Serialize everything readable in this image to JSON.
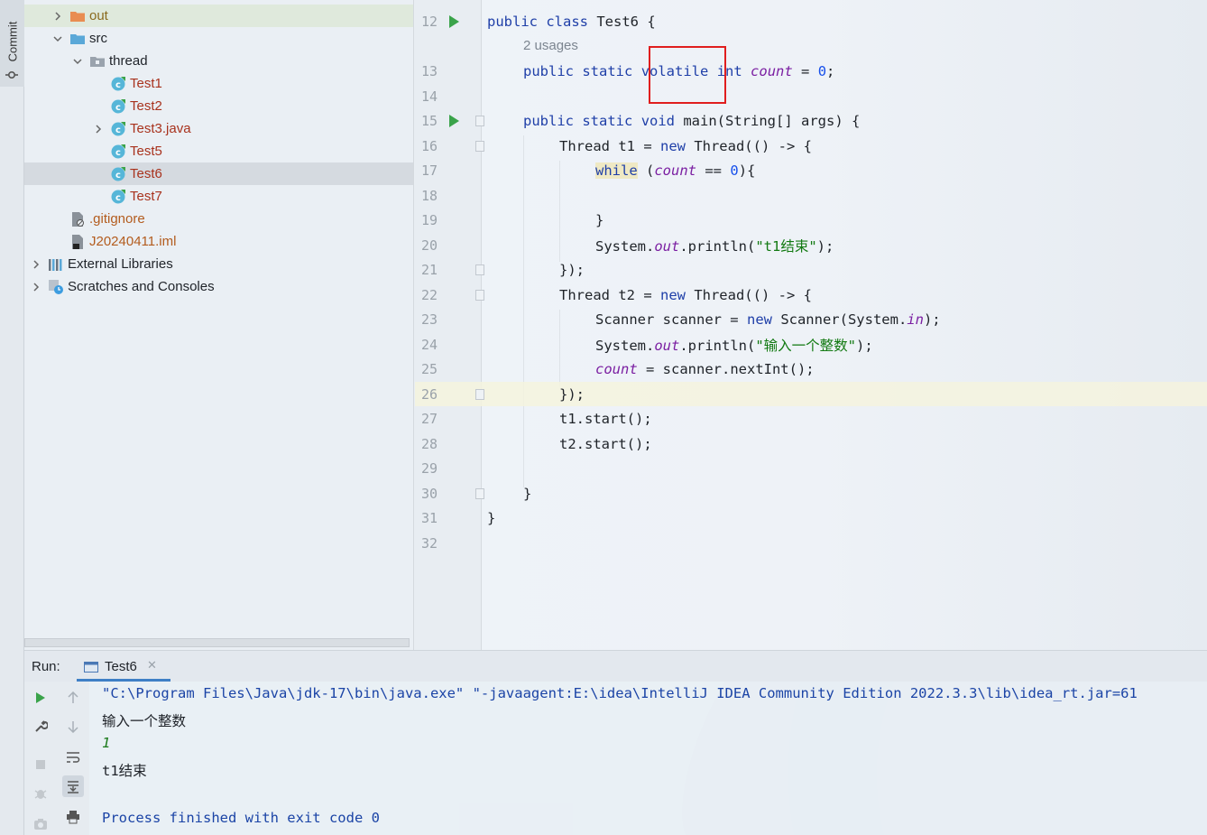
{
  "left_strip": {
    "commit_label": "Commit"
  },
  "project_tree": [
    {
      "label": "out",
      "icon": "folder-orange-icon",
      "expanded": false,
      "color": "olive"
    },
    {
      "label": "src",
      "icon": "folder-blue-icon",
      "expanded": true,
      "color": "default"
    },
    {
      "label": "thread",
      "icon": "package-icon",
      "expanded": true,
      "color": "default"
    },
    {
      "label": "Test1",
      "icon": "java-class-icon",
      "color": "red"
    },
    {
      "label": "Test2",
      "icon": "java-class-icon",
      "color": "red"
    },
    {
      "label": "Test3.java",
      "icon": "java-class-icon",
      "expanded": false,
      "color": "red"
    },
    {
      "label": "Test5",
      "icon": "java-class-icon",
      "color": "red"
    },
    {
      "label": "Test6",
      "icon": "java-class-icon",
      "color": "red",
      "selected": true
    },
    {
      "label": "Test7",
      "icon": "java-class-icon",
      "color": "red"
    },
    {
      "label": ".gitignore",
      "icon": "ignored-file-icon",
      "color": "orange"
    },
    {
      "label": "J20240411.iml",
      "icon": "iml-file-icon",
      "color": "orange"
    },
    {
      "label": "External Libraries",
      "icon": "libraries-icon",
      "expanded": false,
      "color": "default"
    },
    {
      "label": "Scratches and Consoles",
      "icon": "scratches-icon",
      "expanded": false,
      "color": "default"
    }
  ],
  "editor": {
    "usages_hint": "2 usages",
    "current_line": "26",
    "lines": [
      {
        "n": "12",
        "text": "public class Test6 {"
      },
      {
        "n": "13",
        "text": "public static volatile int count = 0;"
      },
      {
        "n": "14",
        "text": ""
      },
      {
        "n": "15",
        "text": "public static void main(String[] args) {"
      },
      {
        "n": "16",
        "text": "Thread t1 = new Thread(() -> {"
      },
      {
        "n": "17",
        "text": "while (count == 0){"
      },
      {
        "n": "18",
        "text": ""
      },
      {
        "n": "19",
        "text": "}"
      },
      {
        "n": "20",
        "text": "System.out.println(\"t1结束\");"
      },
      {
        "n": "21",
        "text": "});"
      },
      {
        "n": "22",
        "text": "Thread t2 = new Thread(() -> {"
      },
      {
        "n": "23",
        "text": "Scanner scanner = new Scanner(System.in);"
      },
      {
        "n": "24",
        "text": "System.out.println(\"输入一个整数\");"
      },
      {
        "n": "25",
        "text": "count = scanner.nextInt();"
      },
      {
        "n": "26",
        "text": "});"
      },
      {
        "n": "27",
        "text": "t1.start();"
      },
      {
        "n": "28",
        "text": "t2.start();"
      },
      {
        "n": "29",
        "text": ""
      },
      {
        "n": "30",
        "text": "}"
      },
      {
        "n": "31",
        "text": "}"
      },
      {
        "n": "32",
        "text": ""
      }
    ]
  },
  "run_panel": {
    "run_label": "Run:",
    "tab_label": "Test6",
    "toolbar_icons": [
      "rerun-icon",
      "scroll-up-icon",
      "wrench-icon",
      "scroll-down-icon",
      "soft-wrap-icon",
      "stop-icon",
      "scroll-to-end-icon",
      "debug-icon",
      "print-icon",
      "camera-icon"
    ],
    "console": [
      {
        "text": "\"C:\\Program Files\\Java\\jdk-17\\bin\\java.exe\" \"-javaagent:E:\\idea\\IntelliJ IDEA Community Edition 2022.3.3\\lib\\idea_rt.jar=61",
        "style": "blue"
      },
      {
        "text": "输入一个整数",
        "style": "dark"
      },
      {
        "text": "1",
        "style": "green"
      },
      {
        "text": "t1结束",
        "style": "dark"
      },
      {
        "text": "",
        "style": "dark"
      },
      {
        "text": "Process finished with exit code 0",
        "style": "blue"
      }
    ]
  },
  "colors": {
    "keyword": "#1f3fa8",
    "field": "#7b1fa2",
    "string": "#137a13",
    "number": "#1750eb",
    "highlight_box": "#e01e1e",
    "run_green": "#3aa34a"
  }
}
